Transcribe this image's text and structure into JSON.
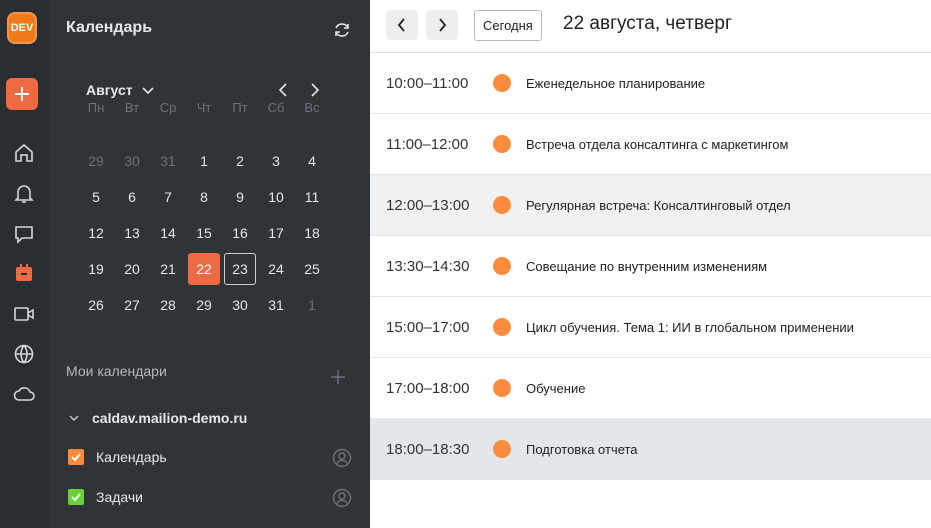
{
  "app": {
    "logo_text": "DEV"
  },
  "rail": {
    "items": [
      "home",
      "notifications",
      "chat",
      "calendar",
      "video",
      "globe",
      "cloud"
    ],
    "active": "calendar",
    "accent": "#ee6a43"
  },
  "panel": {
    "title": "Календарь",
    "month": "Август",
    "weekdays": [
      "Пн",
      "Вт",
      "Ср",
      "Чт",
      "Пт",
      "Сб",
      "Вс"
    ],
    "days": [
      [
        "29",
        "30",
        "31",
        "1",
        "2",
        "3",
        "4"
      ],
      [
        "5",
        "6",
        "7",
        "8",
        "9",
        "10",
        "11"
      ],
      [
        "12",
        "13",
        "14",
        "15",
        "16",
        "17",
        "18"
      ],
      [
        "19",
        "20",
        "21",
        "22",
        "23",
        "24",
        "25"
      ],
      [
        "26",
        "27",
        "28",
        "29",
        "30",
        "31",
        "1"
      ]
    ],
    "selected": "22",
    "today": "23",
    "my_calendars": "Мои календари",
    "account": "caldav.mailion-demo.ru",
    "calendars": [
      {
        "label": "Календарь",
        "color": "#fb8c3e"
      },
      {
        "label": "Задачи",
        "color": "#6bd13a"
      }
    ]
  },
  "main": {
    "today_label": "Сегодня",
    "date": "22 августа, четверг",
    "events": [
      {
        "time": "10:00–11:00",
        "title": "Еженедельное планирование"
      },
      {
        "time": "11:00–12:00",
        "title": "Встреча отдела консалтинга с маркетингом"
      },
      {
        "time": "12:00–13:00",
        "title": "Регулярная встреча: Консалтинговый отдел"
      },
      {
        "time": "13:30–14:30",
        "title": "Совещание по внутренним изменениям"
      },
      {
        "time": "15:00–17:00",
        "title": "Цикл обучения. Тема 1: ИИ в глобальном применении"
      },
      {
        "time": "17:00–18:00",
        "title": "Обучение"
      },
      {
        "time": "18:00–18:30",
        "title": "Подготовка отчета"
      }
    ]
  }
}
